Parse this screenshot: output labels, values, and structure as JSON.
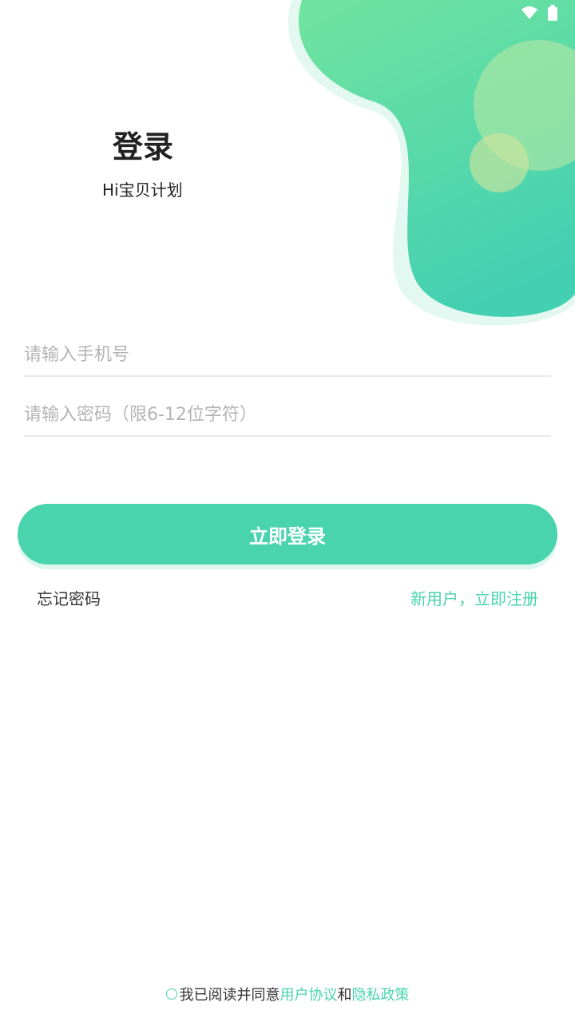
{
  "header": {
    "title": "登录",
    "subtitle": "Hi宝贝计划"
  },
  "form": {
    "phone_placeholder": "请输入手机号",
    "password_placeholder": "请输入密码（限6-12位字符）",
    "login_label": "立即登录"
  },
  "links": {
    "forgot": "忘记密码",
    "register": "新用户，立即注册"
  },
  "agreement": {
    "prefix": "我已阅读并同意",
    "user_agreement": "用户协议",
    "and": "和",
    "privacy_policy": "隐私政策"
  },
  "colors": {
    "accent": "#49d4ae",
    "blob_light": "#6ee3a0",
    "blob_dark": "#43cfb2"
  },
  "icons": {
    "wifi": "wifi-icon",
    "battery": "battery-icon"
  }
}
